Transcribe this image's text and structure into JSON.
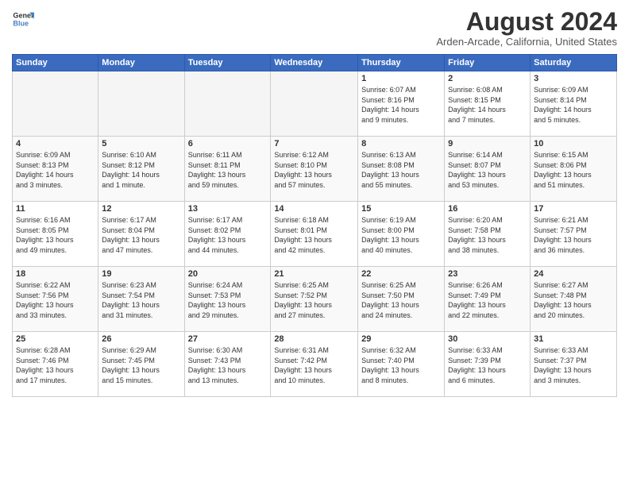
{
  "logo": {
    "general": "General",
    "blue": "Blue"
  },
  "title": "August 2024",
  "location": "Arden-Arcade, California, United States",
  "days_of_week": [
    "Sunday",
    "Monday",
    "Tuesday",
    "Wednesday",
    "Thursday",
    "Friday",
    "Saturday"
  ],
  "weeks": [
    [
      {
        "day": "",
        "info": ""
      },
      {
        "day": "",
        "info": ""
      },
      {
        "day": "",
        "info": ""
      },
      {
        "day": "",
        "info": ""
      },
      {
        "day": "1",
        "info": "Sunrise: 6:07 AM\nSunset: 8:16 PM\nDaylight: 14 hours\nand 9 minutes."
      },
      {
        "day": "2",
        "info": "Sunrise: 6:08 AM\nSunset: 8:15 PM\nDaylight: 14 hours\nand 7 minutes."
      },
      {
        "day": "3",
        "info": "Sunrise: 6:09 AM\nSunset: 8:14 PM\nDaylight: 14 hours\nand 5 minutes."
      }
    ],
    [
      {
        "day": "4",
        "info": "Sunrise: 6:09 AM\nSunset: 8:13 PM\nDaylight: 14 hours\nand 3 minutes."
      },
      {
        "day": "5",
        "info": "Sunrise: 6:10 AM\nSunset: 8:12 PM\nDaylight: 14 hours\nand 1 minute."
      },
      {
        "day": "6",
        "info": "Sunrise: 6:11 AM\nSunset: 8:11 PM\nDaylight: 13 hours\nand 59 minutes."
      },
      {
        "day": "7",
        "info": "Sunrise: 6:12 AM\nSunset: 8:10 PM\nDaylight: 13 hours\nand 57 minutes."
      },
      {
        "day": "8",
        "info": "Sunrise: 6:13 AM\nSunset: 8:08 PM\nDaylight: 13 hours\nand 55 minutes."
      },
      {
        "day": "9",
        "info": "Sunrise: 6:14 AM\nSunset: 8:07 PM\nDaylight: 13 hours\nand 53 minutes."
      },
      {
        "day": "10",
        "info": "Sunrise: 6:15 AM\nSunset: 8:06 PM\nDaylight: 13 hours\nand 51 minutes."
      }
    ],
    [
      {
        "day": "11",
        "info": "Sunrise: 6:16 AM\nSunset: 8:05 PM\nDaylight: 13 hours\nand 49 minutes."
      },
      {
        "day": "12",
        "info": "Sunrise: 6:17 AM\nSunset: 8:04 PM\nDaylight: 13 hours\nand 47 minutes."
      },
      {
        "day": "13",
        "info": "Sunrise: 6:17 AM\nSunset: 8:02 PM\nDaylight: 13 hours\nand 44 minutes."
      },
      {
        "day": "14",
        "info": "Sunrise: 6:18 AM\nSunset: 8:01 PM\nDaylight: 13 hours\nand 42 minutes."
      },
      {
        "day": "15",
        "info": "Sunrise: 6:19 AM\nSunset: 8:00 PM\nDaylight: 13 hours\nand 40 minutes."
      },
      {
        "day": "16",
        "info": "Sunrise: 6:20 AM\nSunset: 7:58 PM\nDaylight: 13 hours\nand 38 minutes."
      },
      {
        "day": "17",
        "info": "Sunrise: 6:21 AM\nSunset: 7:57 PM\nDaylight: 13 hours\nand 36 minutes."
      }
    ],
    [
      {
        "day": "18",
        "info": "Sunrise: 6:22 AM\nSunset: 7:56 PM\nDaylight: 13 hours\nand 33 minutes."
      },
      {
        "day": "19",
        "info": "Sunrise: 6:23 AM\nSunset: 7:54 PM\nDaylight: 13 hours\nand 31 minutes."
      },
      {
        "day": "20",
        "info": "Sunrise: 6:24 AM\nSunset: 7:53 PM\nDaylight: 13 hours\nand 29 minutes."
      },
      {
        "day": "21",
        "info": "Sunrise: 6:25 AM\nSunset: 7:52 PM\nDaylight: 13 hours\nand 27 minutes."
      },
      {
        "day": "22",
        "info": "Sunrise: 6:25 AM\nSunset: 7:50 PM\nDaylight: 13 hours\nand 24 minutes."
      },
      {
        "day": "23",
        "info": "Sunrise: 6:26 AM\nSunset: 7:49 PM\nDaylight: 13 hours\nand 22 minutes."
      },
      {
        "day": "24",
        "info": "Sunrise: 6:27 AM\nSunset: 7:48 PM\nDaylight: 13 hours\nand 20 minutes."
      }
    ],
    [
      {
        "day": "25",
        "info": "Sunrise: 6:28 AM\nSunset: 7:46 PM\nDaylight: 13 hours\nand 17 minutes."
      },
      {
        "day": "26",
        "info": "Sunrise: 6:29 AM\nSunset: 7:45 PM\nDaylight: 13 hours\nand 15 minutes."
      },
      {
        "day": "27",
        "info": "Sunrise: 6:30 AM\nSunset: 7:43 PM\nDaylight: 13 hours\nand 13 minutes."
      },
      {
        "day": "28",
        "info": "Sunrise: 6:31 AM\nSunset: 7:42 PM\nDaylight: 13 hours\nand 10 minutes."
      },
      {
        "day": "29",
        "info": "Sunrise: 6:32 AM\nSunset: 7:40 PM\nDaylight: 13 hours\nand 8 minutes."
      },
      {
        "day": "30",
        "info": "Sunrise: 6:33 AM\nSunset: 7:39 PM\nDaylight: 13 hours\nand 6 minutes."
      },
      {
        "day": "31",
        "info": "Sunrise: 6:33 AM\nSunset: 7:37 PM\nDaylight: 13 hours\nand 3 minutes."
      }
    ]
  ]
}
